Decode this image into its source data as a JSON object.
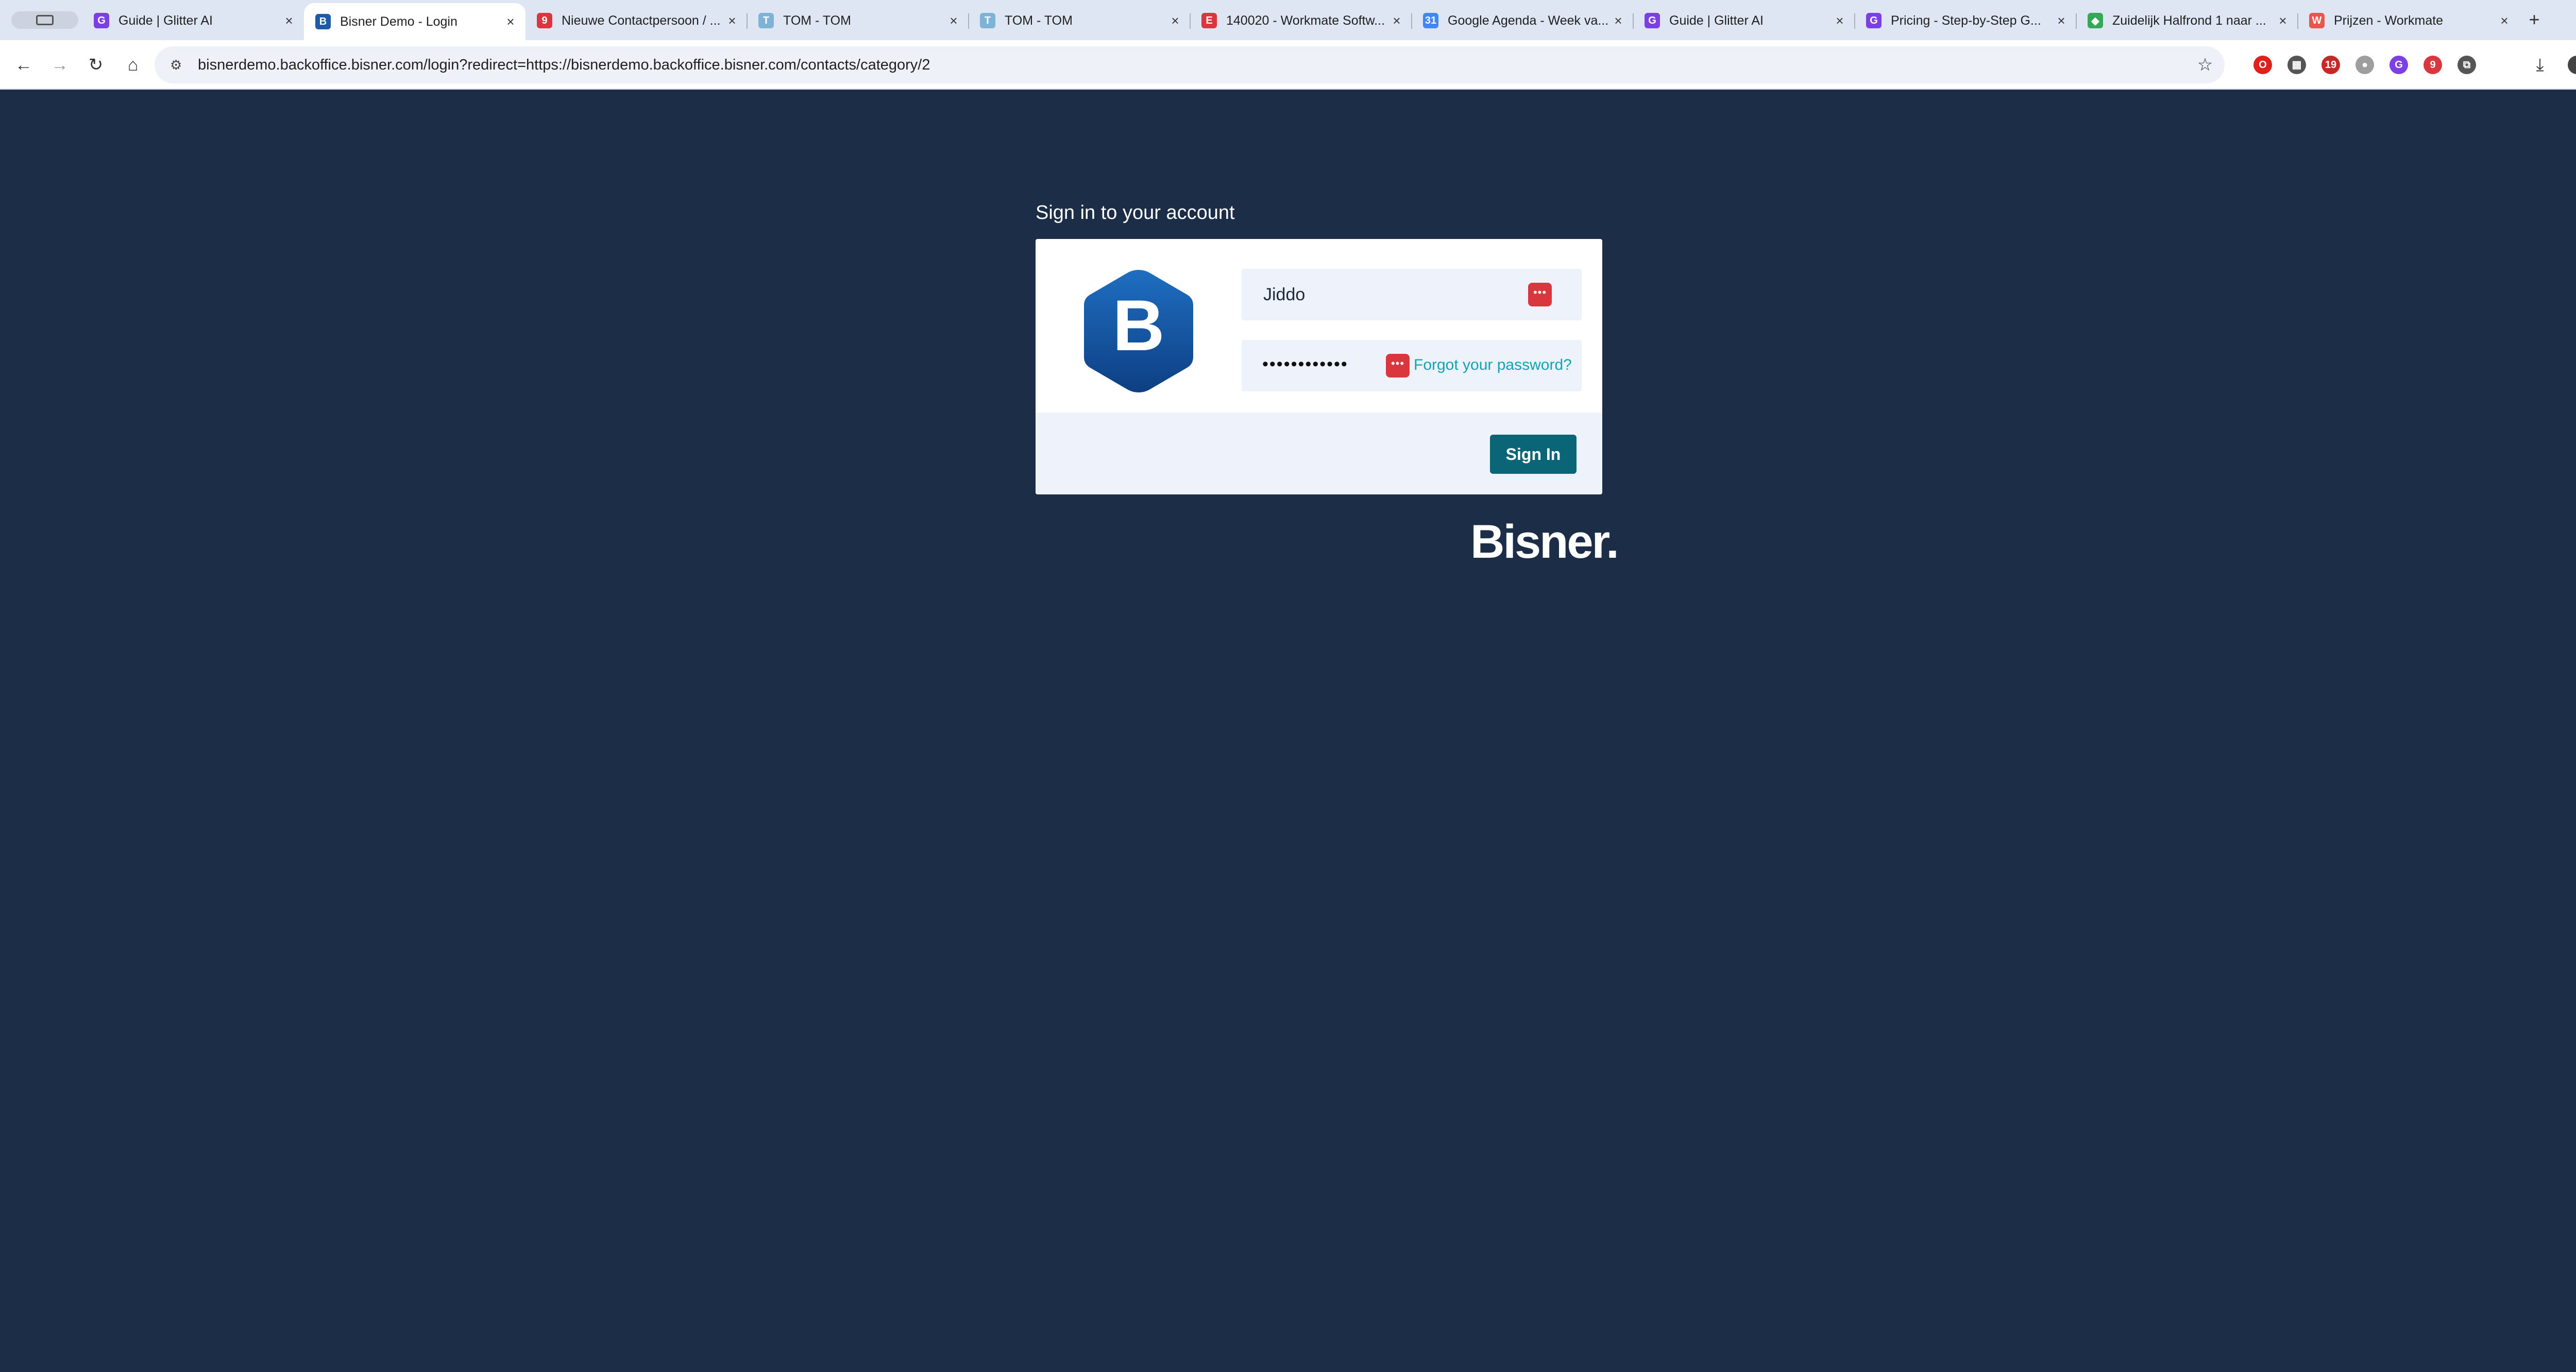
{
  "browser": {
    "tabs": [
      {
        "title": "Guide | Glitter AI",
        "icon": "glitter-g-icon",
        "color": "#7b3fe4",
        "glyph": "G"
      },
      {
        "title": "Bisner Demo - Login",
        "icon": "bisner-b-icon",
        "color": "#1e5aa8",
        "glyph": "B",
        "active": true
      },
      {
        "title": "Nieuwe Contactpersoon / ...",
        "icon": "red-circle-icon",
        "color": "#d9363e",
        "glyph": "9"
      },
      {
        "title": "TOM - TOM",
        "icon": "tom-icon",
        "color": "#7fb3d5",
        "glyph": "T"
      },
      {
        "title": "TOM - TOM",
        "icon": "tom-icon",
        "color": "#7fb3d5",
        "glyph": "T"
      },
      {
        "title": "140020 - Workmate Softw...",
        "icon": "workmate-e-icon",
        "color": "#d9363e",
        "glyph": "E"
      },
      {
        "title": "Google Agenda - Week va...",
        "icon": "google-calendar-icon",
        "color": "#4285f4",
        "glyph": "31"
      },
      {
        "title": "Guide | Glitter AI",
        "icon": "glitter-g-icon",
        "color": "#7b3fe4",
        "glyph": "G"
      },
      {
        "title": "Pricing - Step-by-Step G...",
        "icon": "glitter-g-icon",
        "color": "#7b3fe4",
        "glyph": "G"
      },
      {
        "title": "Zuidelijk Halfrond 1 naar ...",
        "icon": "maps-pin-icon",
        "color": "#34a853",
        "glyph": "◆"
      },
      {
        "title": "Prijzen - Workmate",
        "icon": "workmate-w-icon",
        "color": "#e8574d",
        "glyph": "W"
      }
    ],
    "close_glyph": "×",
    "newtab_glyph": "+",
    "url": "bisnerdemo.backoffice.bisner.com/login?redirect=https://bisnerdemo.backoffice.bisner.com/contacts/category/2",
    "extensions": [
      {
        "icon": "opera-icon",
        "color": "#e0201b",
        "glyph": "O"
      },
      {
        "icon": "qr-icon",
        "color": "#555555",
        "glyph": "▦"
      },
      {
        "icon": "calendar-badge-icon",
        "color": "#c62828",
        "glyph": "19"
      },
      {
        "icon": "grey-circle-icon",
        "color": "#9e9e9e",
        "glyph": "●"
      },
      {
        "icon": "glitter-g-icon",
        "color": "#7b3fe4",
        "glyph": "G"
      },
      {
        "icon": "red-9-icon",
        "color": "#d9363e",
        "glyph": "9"
      },
      {
        "icon": "puzzle-icon",
        "color": "#555555",
        "glyph": "⧉"
      }
    ]
  },
  "login": {
    "heading": "Sign in to your account",
    "username_value": "Jiddo",
    "password_mask": "••••••••••••",
    "forgot_label": "Forgot your password?",
    "signin_label": "Sign In",
    "logo_letter": "B",
    "brand": "Bisner."
  }
}
